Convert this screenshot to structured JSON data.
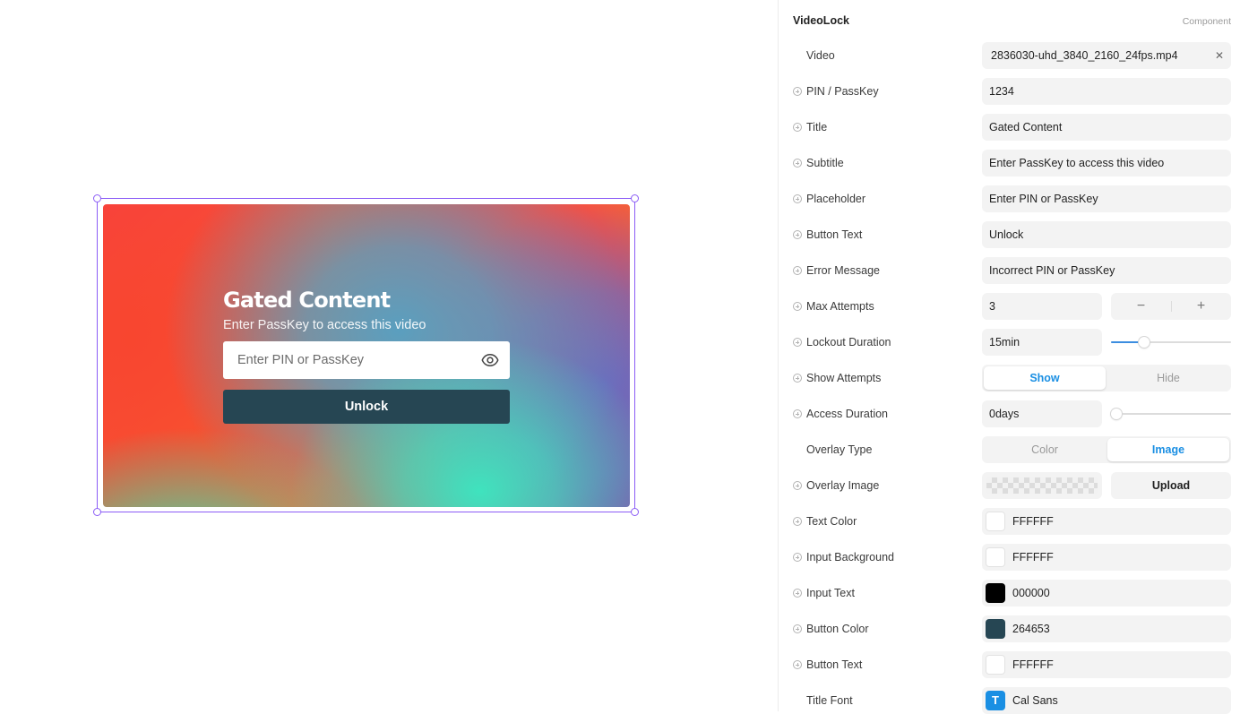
{
  "preview": {
    "title": "Gated Content",
    "subtitle": "Enter PassKey to access this video",
    "placeholder": "Enter PIN or PassKey",
    "button": "Unlock",
    "button_color": "#264653",
    "text_color": "#FFFFFF"
  },
  "panel": {
    "title": "VideoLock",
    "kind": "Component",
    "video": {
      "label": "Video",
      "value": "2836030-uhd_3840_2160_24fps.mp4"
    },
    "pin": {
      "label": "PIN / PassKey",
      "value": "1234"
    },
    "title_prop": {
      "label": "Title",
      "value": "Gated Content"
    },
    "subtitle": {
      "label": "Subtitle",
      "value": "Enter PassKey to access this video"
    },
    "placeholder": {
      "label": "Placeholder",
      "value": "Enter PIN or PassKey"
    },
    "button_text": {
      "label": "Button Text",
      "value": "Unlock"
    },
    "error_message": {
      "label": "Error Message",
      "value": "Incorrect PIN or PassKey"
    },
    "max_attempts": {
      "label": "Max Attempts",
      "value": "3",
      "minus": "−",
      "plus": "+"
    },
    "lockout_duration": {
      "label": "Lockout Duration",
      "value": "15min",
      "slider_fraction": 0.25
    },
    "show_attempts": {
      "label": "Show Attempts",
      "options": [
        "Show",
        "Hide"
      ],
      "selected": "Show"
    },
    "access_duration": {
      "label": "Access Duration",
      "value": "0days",
      "slider_fraction": 0.0
    },
    "overlay_type": {
      "label": "Overlay Type",
      "options": [
        "Color",
        "Image"
      ],
      "selected": "Image"
    },
    "overlay_image": {
      "label": "Overlay Image",
      "upload": "Upload"
    },
    "text_color": {
      "label": "Text Color",
      "value": "FFFFFF",
      "swatch": "#FFFFFF"
    },
    "input_background": {
      "label": "Input Background",
      "value": "FFFFFF",
      "swatch": "#FFFFFF"
    },
    "input_text": {
      "label": "Input Text",
      "value": "000000",
      "swatch": "#000000"
    },
    "button_color": {
      "label": "Button Color",
      "value": "264653",
      "swatch": "#264653"
    },
    "button_text_color": {
      "label": "Button Text",
      "value": "FFFFFF",
      "swatch": "#FFFFFF"
    },
    "title_font": {
      "label": "Title Font",
      "value": "Cal Sans",
      "icon": "T"
    }
  }
}
